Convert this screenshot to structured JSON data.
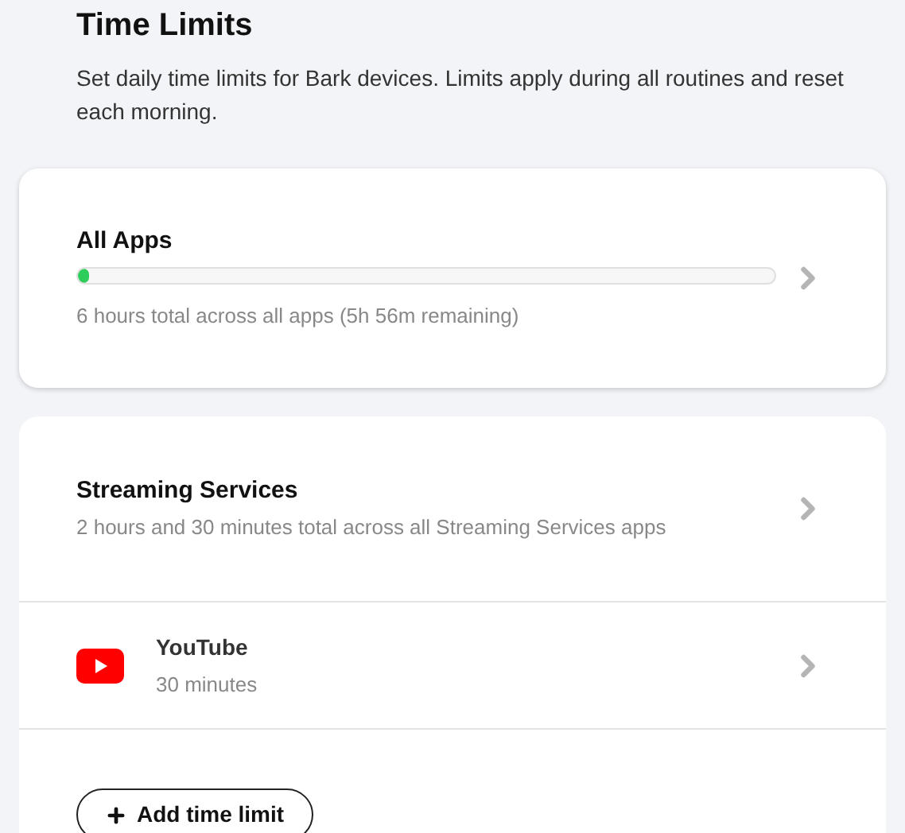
{
  "header": {
    "title": "Time Limits",
    "description": "Set daily time limits for Bark devices. Limits apply during all routines and reset each morning."
  },
  "overall": {
    "title": "All Apps",
    "level": 0.015,
    "summary": "6 hours total across all apps (5h 56m remaining)"
  },
  "category": {
    "title": "Streaming Services",
    "summary": "2 hours and 30 minutes total across all Streaming Services apps",
    "apps": [
      {
        "kind": "youtube",
        "name": "YouTube",
        "limit": "30 minutes"
      }
    ]
  },
  "add_button": {
    "label": "Add time limit"
  }
}
